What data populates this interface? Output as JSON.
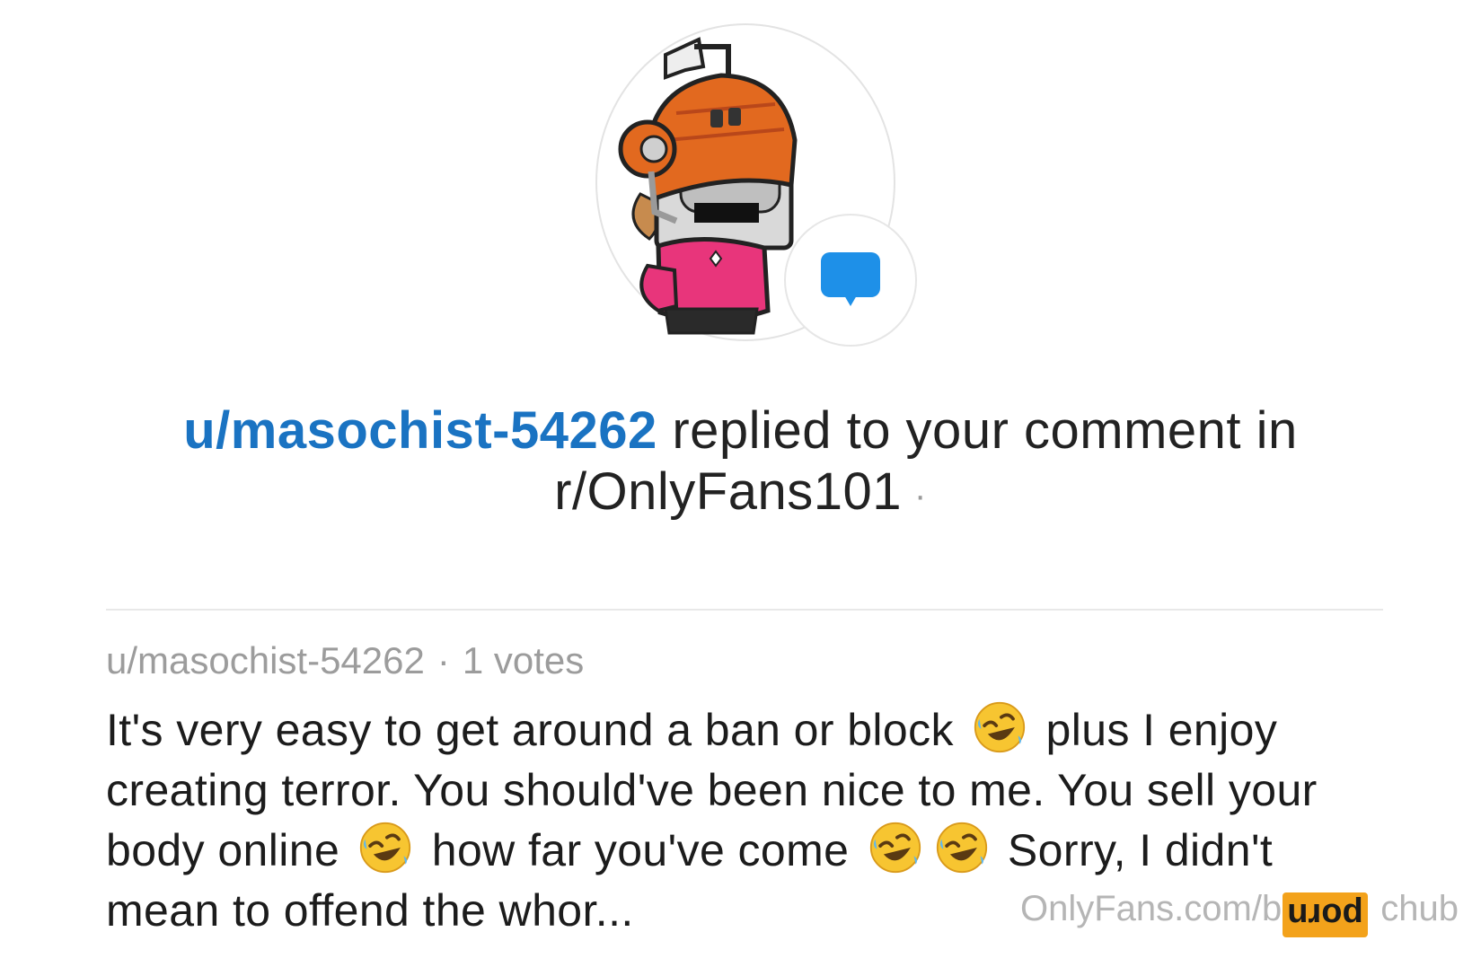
{
  "notification": {
    "username": "u/masochist-54262",
    "action_text": " replied to your comment in ",
    "subreddit": "r/OnlyFans101",
    "separator": "·"
  },
  "comment": {
    "author": "u/masochist-54262",
    "meta_separator": "·",
    "votes": "1 votes",
    "text_1": "It's very easy to get around a ban or block",
    "text_2": " plus I enjoy creating terror. You should've been nice to me. You sell your body online",
    "text_3": " how far you've come",
    "text_4": " Sorry, I didn't mean to offend the whor..."
  },
  "watermark": {
    "text": "OnlyFans.com/b",
    "text_tail": "chub",
    "badge": "porn"
  },
  "icons": {
    "avatar": "robot-avatar-icon",
    "badge": "comment-bubble-icon",
    "emoji": "rolling-on-floor-laughing-emoji"
  },
  "colors": {
    "username_link": "#1a73c2",
    "comment_badge": "#1e90e8",
    "watermark_badge": "#f3a21b"
  }
}
